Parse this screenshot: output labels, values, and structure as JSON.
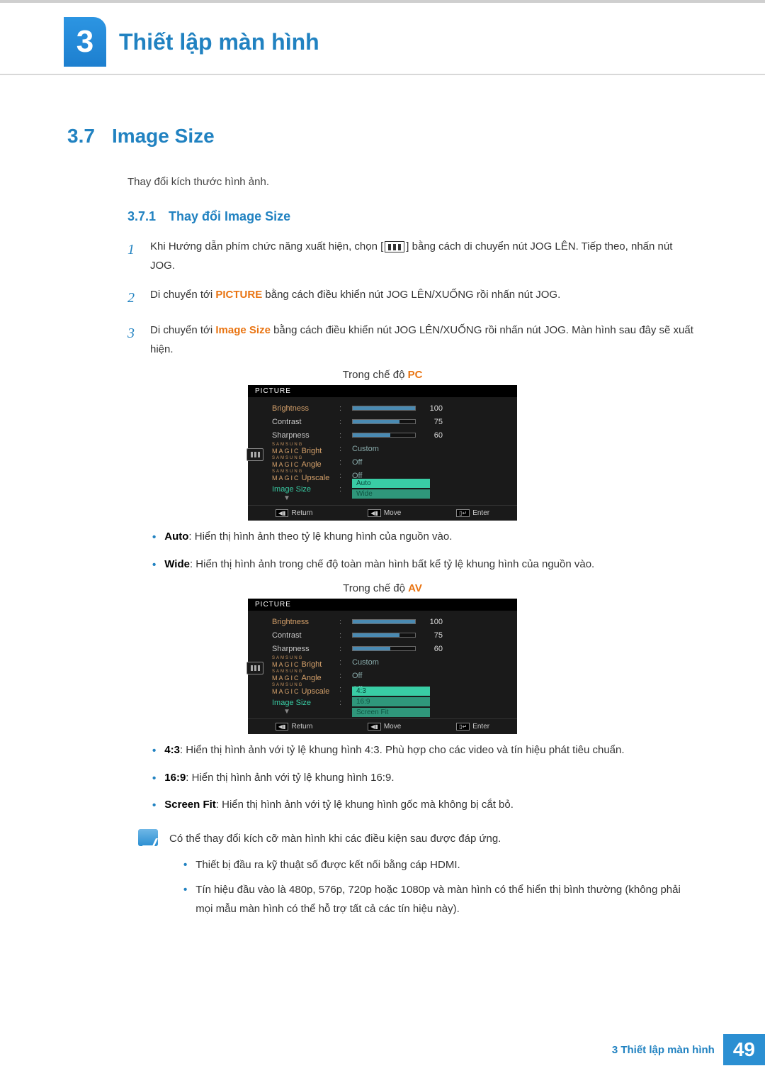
{
  "chapter": {
    "number": "3",
    "title": "Thiết lập màn hình"
  },
  "section": {
    "number": "3.7",
    "title": "Image Size"
  },
  "intro": "Thay đổi kích thước hình ảnh.",
  "subsection": {
    "number": "3.7.1",
    "title": "Thay đổi Image Size"
  },
  "steps": {
    "s1a": "Khi Hướng dẫn phím chức năng xuất hiện, chọn [",
    "s1b": "] bằng cách di chuyển nút JOG LÊN. Tiếp theo, nhấn nút JOG.",
    "s2a": "Di chuyển tới ",
    "s2b": "PICTURE",
    "s2c": " bằng cách điều khiển nút JOG LÊN/XUỐNG rồi nhấn nút JOG.",
    "s3a": "Di chuyển tới ",
    "s3b": "Image Size",
    "s3c": " bằng cách điều khiển nút JOG LÊN/XUỐNG rồi nhấn nút JOG. Màn hình sau đây sẽ xuất hiện."
  },
  "captions": {
    "pc_pre": "Trong chế độ ",
    "pc_mode": "PC",
    "av_pre": "Trong chế độ ",
    "av_mode": "AV"
  },
  "osd": {
    "title": "PICTURE",
    "brightness": "Brightness",
    "contrast": "Contrast",
    "sharpness": "Sharpness",
    "magic_sup": "SAMSUNG",
    "magic": "MAGIC",
    "bright": "Bright",
    "angle": "Angle",
    "upscale": "Upscale",
    "image_size": "Image Size",
    "custom": "Custom",
    "off": "Off",
    "val_bright": "100",
    "val_contrast": "75",
    "val_sharp": "60",
    "opt_auto": "Auto",
    "opt_wide": "Wide",
    "opt_43": "4:3",
    "opt_169": "16:9",
    "opt_sf": "Screen Fit",
    "return": "Return",
    "move": "Move",
    "enter": "Enter"
  },
  "bullets_pc": {
    "auto_l": "Auto",
    "auto_t": ": Hiển thị hình ảnh theo tỷ lệ khung hình của nguồn vào.",
    "wide_l": "Wide",
    "wide_t": ": Hiển thị hình ảnh trong chế độ toàn màn hình bất kể tỷ lệ khung hình của nguồn vào."
  },
  "bullets_av": {
    "r43_l": "4:3",
    "r43_t": ": Hiển thị hình ảnh với tỷ lệ khung hình 4:3. Phù hợp cho các video và tín hiệu phát tiêu chuẩn.",
    "r169_l": "16:9",
    "r169_t": ": Hiển thị hình ảnh với tỷ lệ khung hình 16:9.",
    "sf_l": "Screen Fit",
    "sf_t": ": Hiển thị hình ảnh với tỷ lệ khung hình gốc mà không bị cắt bỏ."
  },
  "note": {
    "intro": "Có thể thay đổi kích cỡ màn hình khi các điều kiện sau được đáp ứng.",
    "b1": "Thiết bị đầu ra kỹ thuật số được kết nối bằng cáp HDMI.",
    "b2": "Tín hiệu đầu vào là 480p, 576p, 720p hoặc 1080p và màn hình có thể hiển thị bình thường (không phải mọi mẫu màn hình có thể hỗ trợ tất cả các tín hiệu này)."
  },
  "footer": {
    "label": "3 Thiết lập màn hình",
    "page": "49"
  }
}
